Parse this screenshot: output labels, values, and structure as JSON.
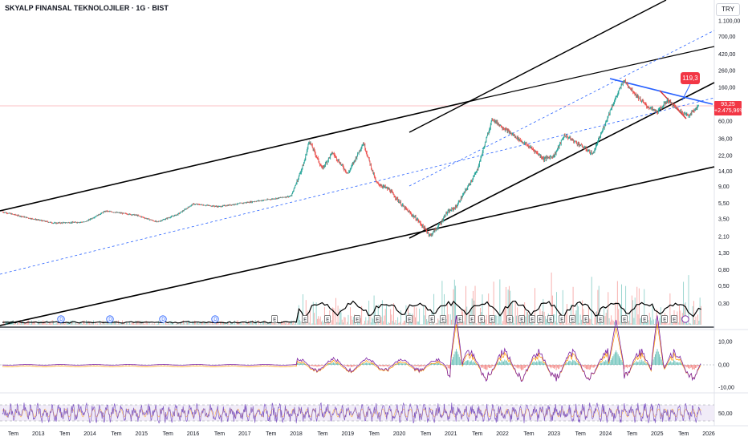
{
  "header": {
    "symbol_title": "SKYALP FINANSAL TEKNOLOJILER · 1G · BIST",
    "currency": "TRY"
  },
  "price_label": {
    "price": "93,25",
    "change": "+2.475,96%"
  },
  "callout": {
    "value": "119,3"
  },
  "colors": {
    "up": "#26a69a",
    "down": "#ef5350",
    "trendline": "#000000",
    "dashed_channel": "#2962ff",
    "blue_segment": "#2962ff",
    "red_segment": "#d32f2f",
    "price_line": "#f23645",
    "macd": "#7b1fa2",
    "macd_signal": "#ff9800",
    "rsi": "#7e57c2",
    "rsi_band": "#ede7f6"
  },
  "chart_data": [
    {
      "type": "line",
      "name": "price",
      "scale": "log",
      "y_ticks": [
        "1.100,00",
        "700,00",
        "420,00",
        "260,00",
        "160,00",
        "93,25",
        "60,00",
        "36,00",
        "22,00",
        "14,00",
        "9,00",
        "5,50",
        "3,50",
        "2,10",
        "1,30",
        "0,80",
        "0,50",
        "0,30"
      ],
      "x_ticks": [
        "Tem",
        "2013",
        "Tem",
        "2014",
        "Tem",
        "2015",
        "Tem",
        "2016",
        "Tem",
        "2017",
        "Tem",
        "2018",
        "Tem",
        "2019",
        "Tem",
        "2020",
        "Tem",
        "2021",
        "Tem",
        "2022",
        "Tem",
        "2023",
        "Tem",
        "2024",
        "Tem",
        "2025",
        "Tem",
        "2026"
      ],
      "x": [
        2012.3,
        2012.8,
        2013.3,
        2013.9,
        2014.3,
        2014.9,
        2015.3,
        2015.7,
        2016.0,
        2016.5,
        2017.0,
        2017.5,
        2017.9,
        2018.15,
        2018.25,
        2018.5,
        2018.7,
        2019.0,
        2019.3,
        2019.55,
        2019.8,
        2020.1,
        2020.35,
        2020.6,
        2020.8,
        2020.9,
        2021.1,
        2021.5,
        2021.8,
        2022.0,
        2022.3,
        2022.6,
        2022.8,
        2023.0,
        2023.2,
        2023.5,
        2023.75,
        2023.95,
        2024.1,
        2024.35,
        2024.6,
        2024.8,
        2025.0,
        2025.2,
        2025.4,
        2025.6,
        2025.8
      ],
      "y": [
        4.3,
        3.6,
        3.1,
        3.2,
        4.4,
        3.9,
        3.2,
        4.0,
        5.4,
        5.0,
        5.6,
        6.2,
        6.8,
        18,
        34,
        15,
        24,
        13,
        32,
        10,
        8.2,
        4.8,
        3.4,
        2.15,
        3.1,
        4.1,
        5.0,
        14,
        64,
        50,
        36,
        26,
        20,
        22,
        40,
        30,
        23,
        48,
        86,
        196,
        125,
        92,
        78,
        110,
        84,
        70,
        93.25
      ]
    },
    {
      "type": "bar",
      "name": "volume",
      "events_dividend": [
        "D",
        "D",
        "D",
        "D"
      ],
      "events_earnings": [
        "E",
        "E",
        "E",
        "E",
        "E",
        "E",
        "E",
        "E",
        "E",
        "E",
        "E",
        "E",
        "E",
        "E",
        "E",
        "E",
        "E",
        "E",
        "E",
        "E",
        "E",
        "E",
        "E",
        "E",
        "E"
      ]
    },
    {
      "type": "line",
      "name": "macd",
      "y_ticks": [
        "10,00",
        "0,00",
        "-10,00"
      ]
    },
    {
      "type": "line",
      "name": "rsi",
      "y_ticks": [
        "50,00"
      ]
    }
  ]
}
